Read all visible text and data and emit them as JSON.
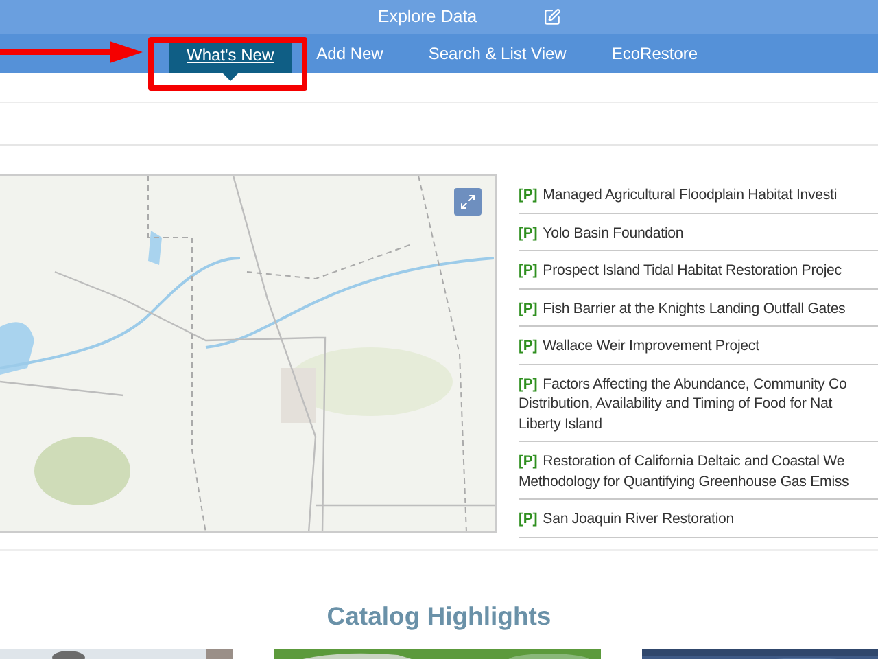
{
  "top_bar": {
    "title": "Explore Data"
  },
  "nav": {
    "tabs": [
      {
        "label": "What's New",
        "selected": true,
        "highlighted": true
      },
      {
        "label": "Add New",
        "selected": false,
        "highlighted": false
      },
      {
        "label": "Search & List View",
        "selected": false,
        "highlighted": false
      },
      {
        "label": "EcoRestore",
        "selected": false,
        "highlighted": false
      }
    ]
  },
  "projects": [
    {
      "tag": "[P]",
      "lines": [
        "Managed Agricultural Floodplain Habitat Investi"
      ]
    },
    {
      "tag": "[P]",
      "lines": [
        "Yolo Basin Foundation"
      ]
    },
    {
      "tag": "[P]",
      "lines": [
        "Prospect Island Tidal Habitat Restoration Projec"
      ]
    },
    {
      "tag": "[P]",
      "lines": [
        "Fish Barrier at the Knights Landing Outfall Gates"
      ]
    },
    {
      "tag": "[P]",
      "lines": [
        "Wallace Weir Improvement Project"
      ]
    },
    {
      "tag": "[P]",
      "lines": [
        "Factors Affecting the Abundance, Community Co",
        "Distribution, Availability and Timing of Food for Nat",
        "Liberty Island"
      ]
    },
    {
      "tag": "[P]",
      "lines": [
        "Restoration of California Deltaic and Coastal We",
        "Methodology for Quantifying Greenhouse Gas Emiss"
      ]
    },
    {
      "tag": "[P]",
      "lines": [
        "San Joaquin River Restoration"
      ]
    }
  ],
  "highlights": {
    "title": "Catalog Highlights"
  }
}
